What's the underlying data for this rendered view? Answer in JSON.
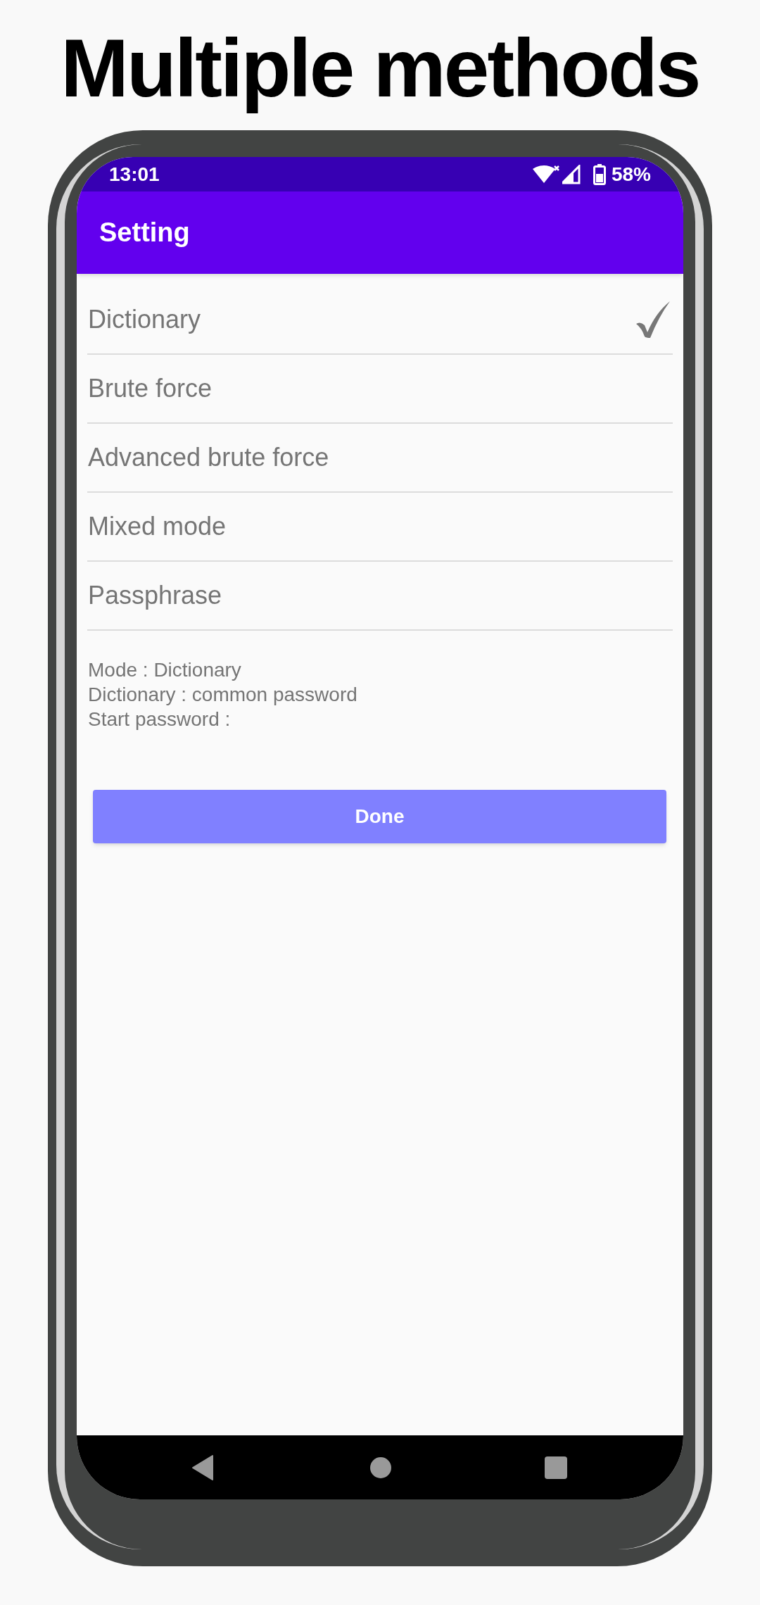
{
  "title": "Multiple methods",
  "status_bar": {
    "time": "13:01",
    "battery": "58%"
  },
  "app_bar": {
    "title": "Setting"
  },
  "methods": [
    {
      "label": "Dictionary",
      "selected": true
    },
    {
      "label": "Brute force",
      "selected": false
    },
    {
      "label": "Advanced brute force",
      "selected": false
    },
    {
      "label": "Mixed mode",
      "selected": false
    },
    {
      "label": "Passphrase",
      "selected": false
    }
  ],
  "info_lines": [
    "Mode : Dictionary",
    "Dictionary : common password",
    "Start password :"
  ],
  "done_button": "Done"
}
